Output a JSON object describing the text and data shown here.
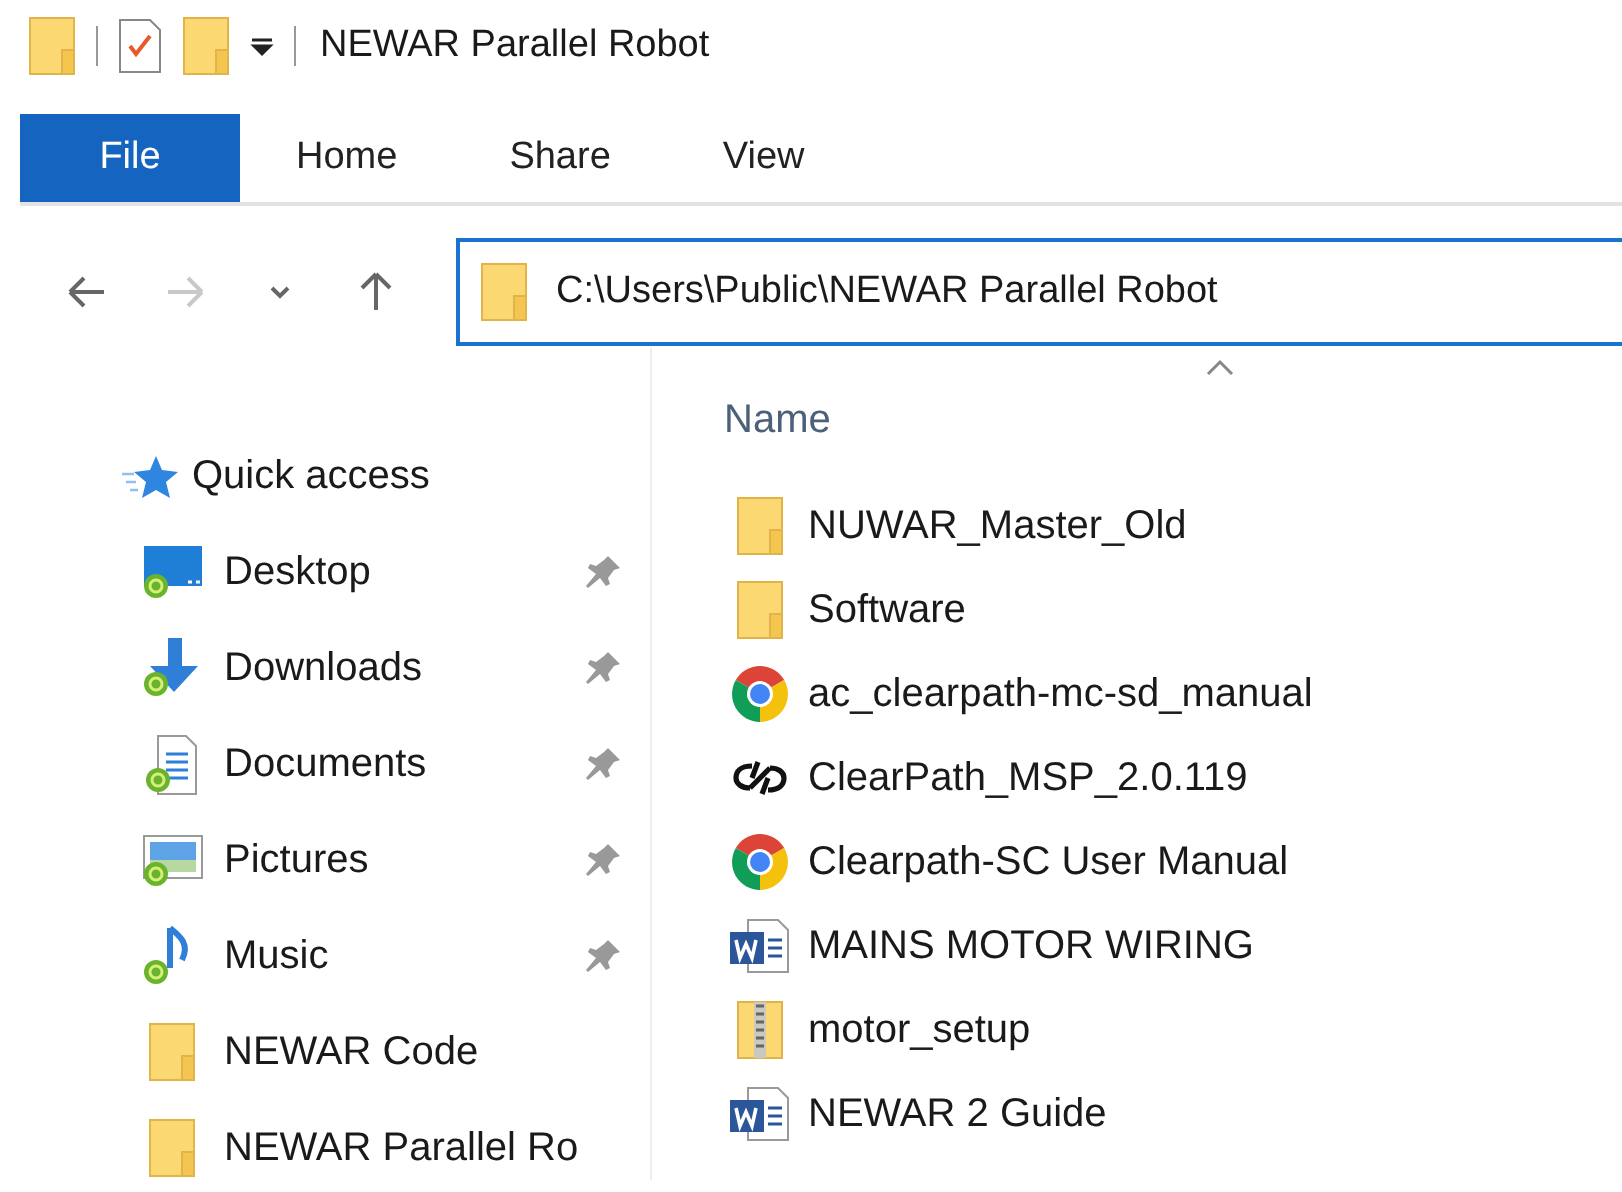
{
  "window": {
    "title": "NEWAR Parallel Robot"
  },
  "ribbon_tabs": [
    {
      "label": "File",
      "kind": "file"
    },
    {
      "label": "Home",
      "kind": "tab"
    },
    {
      "label": "Share",
      "kind": "tab"
    },
    {
      "label": "View",
      "kind": "tab"
    }
  ],
  "address_bar": {
    "value": "C:\\Users\\Public\\NEWAR Parallel Robot"
  },
  "nav_buttons": [
    {
      "kind": "back",
      "disabled": false
    },
    {
      "kind": "forward",
      "disabled": true
    },
    {
      "kind": "recent",
      "disabled": false
    },
    {
      "kind": "up",
      "disabled": false
    }
  ],
  "sidebar": {
    "header": "Quick access",
    "items": [
      {
        "label": "Desktop",
        "kind": "desktop",
        "pinned": true
      },
      {
        "label": "Downloads",
        "kind": "downloads",
        "pinned": true
      },
      {
        "label": "Documents",
        "kind": "documents",
        "pinned": true
      },
      {
        "label": "Pictures",
        "kind": "pictures",
        "pinned": true
      },
      {
        "label": "Music",
        "kind": "music",
        "pinned": true
      },
      {
        "label": "NEWAR Code",
        "kind": "folder",
        "pinned": false
      },
      {
        "label": "NEWAR Parallel Ro",
        "kind": "folder",
        "pinned": false
      }
    ]
  },
  "file_list": {
    "column": "Name",
    "sort_ascending": true,
    "files": [
      {
        "name": "NUWAR_Master_Old",
        "kind": "folder"
      },
      {
        "name": "Software",
        "kind": "folder"
      },
      {
        "name": "ac_clearpath-mc-sd_manual",
        "kind": "chrome"
      },
      {
        "name": "ClearPath_MSP_2.0.119",
        "kind": "app"
      },
      {
        "name": "Clearpath-SC User Manual",
        "kind": "chrome"
      },
      {
        "name": "MAINS MOTOR WIRING",
        "kind": "word"
      },
      {
        "name": "motor_setup",
        "kind": "zip"
      },
      {
        "name": "NEWAR 2 Guide",
        "kind": "word"
      }
    ]
  }
}
